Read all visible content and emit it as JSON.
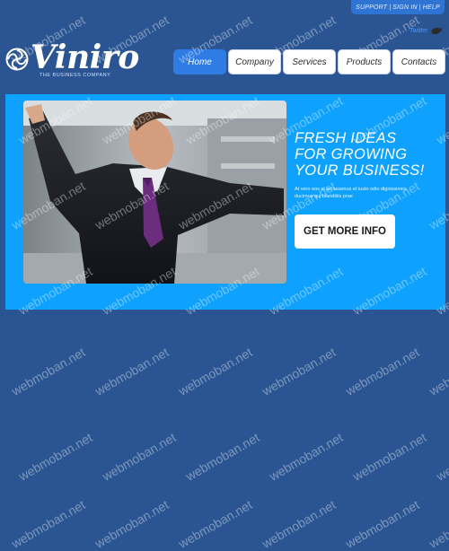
{
  "top_links": [
    "SUPPORT",
    "SIGN IN",
    "HELP"
  ],
  "twitter_label": "Twitter",
  "logo": {
    "name": "Viniro",
    "tagline": "THE BUSINESS COMPANY"
  },
  "nav": [
    {
      "label": "Home",
      "active": true
    },
    {
      "label": "Company",
      "active": false
    },
    {
      "label": "Services",
      "active": false
    },
    {
      "label": "Products",
      "active": false
    },
    {
      "label": "Contacts",
      "active": false
    }
  ],
  "hero": {
    "heading_lines": [
      "FRESH IDEAS",
      "FOR GROWING",
      "YOUR BUSINESS!"
    ],
    "body": "At vero eos et accusamus et iusto odio dignissimos ducimus qui blanditiis prae",
    "cta": "GET MORE INFO"
  },
  "colors": {
    "page_bg": "#2a5592",
    "hero_bg": "#0ea2fe",
    "nav_active": "#2f7ce4"
  },
  "watermark_text": "webmoban.net"
}
